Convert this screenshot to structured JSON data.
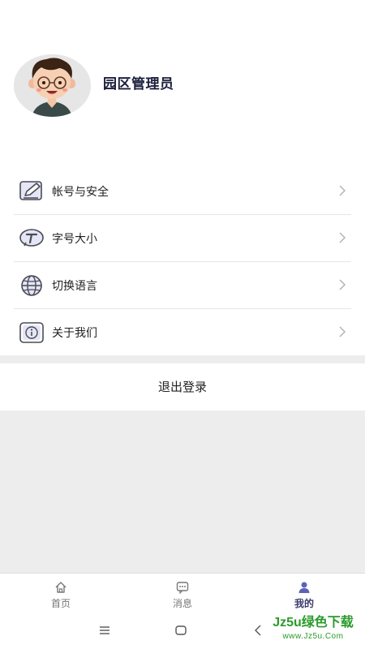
{
  "profile": {
    "username": "园区管理员",
    "avatar_icon": "cartoon-avatar"
  },
  "menu": {
    "items": [
      {
        "label": "帐号与安全",
        "icon": "edit-icon"
      },
      {
        "label": "字号大小",
        "icon": "font-size-icon"
      },
      {
        "label": "切换语言",
        "icon": "globe-icon"
      },
      {
        "label": "关于我们",
        "icon": "info-icon"
      }
    ]
  },
  "logout": {
    "label": "退出登录"
  },
  "tabbar": {
    "tabs": [
      {
        "label": "首页",
        "icon": "home-icon",
        "active": false
      },
      {
        "label": "消息",
        "icon": "message-icon",
        "active": false
      },
      {
        "label": "我的",
        "icon": "user-icon",
        "active": true
      }
    ]
  },
  "watermark": {
    "line1": "Jz5u绿色下载",
    "line2": "www.Jz5u.Com"
  },
  "colors": {
    "accent": "#3b3b6b",
    "divider": "#e6e6e6",
    "background_gray": "#ededed",
    "watermark": "#2a9a2a"
  }
}
